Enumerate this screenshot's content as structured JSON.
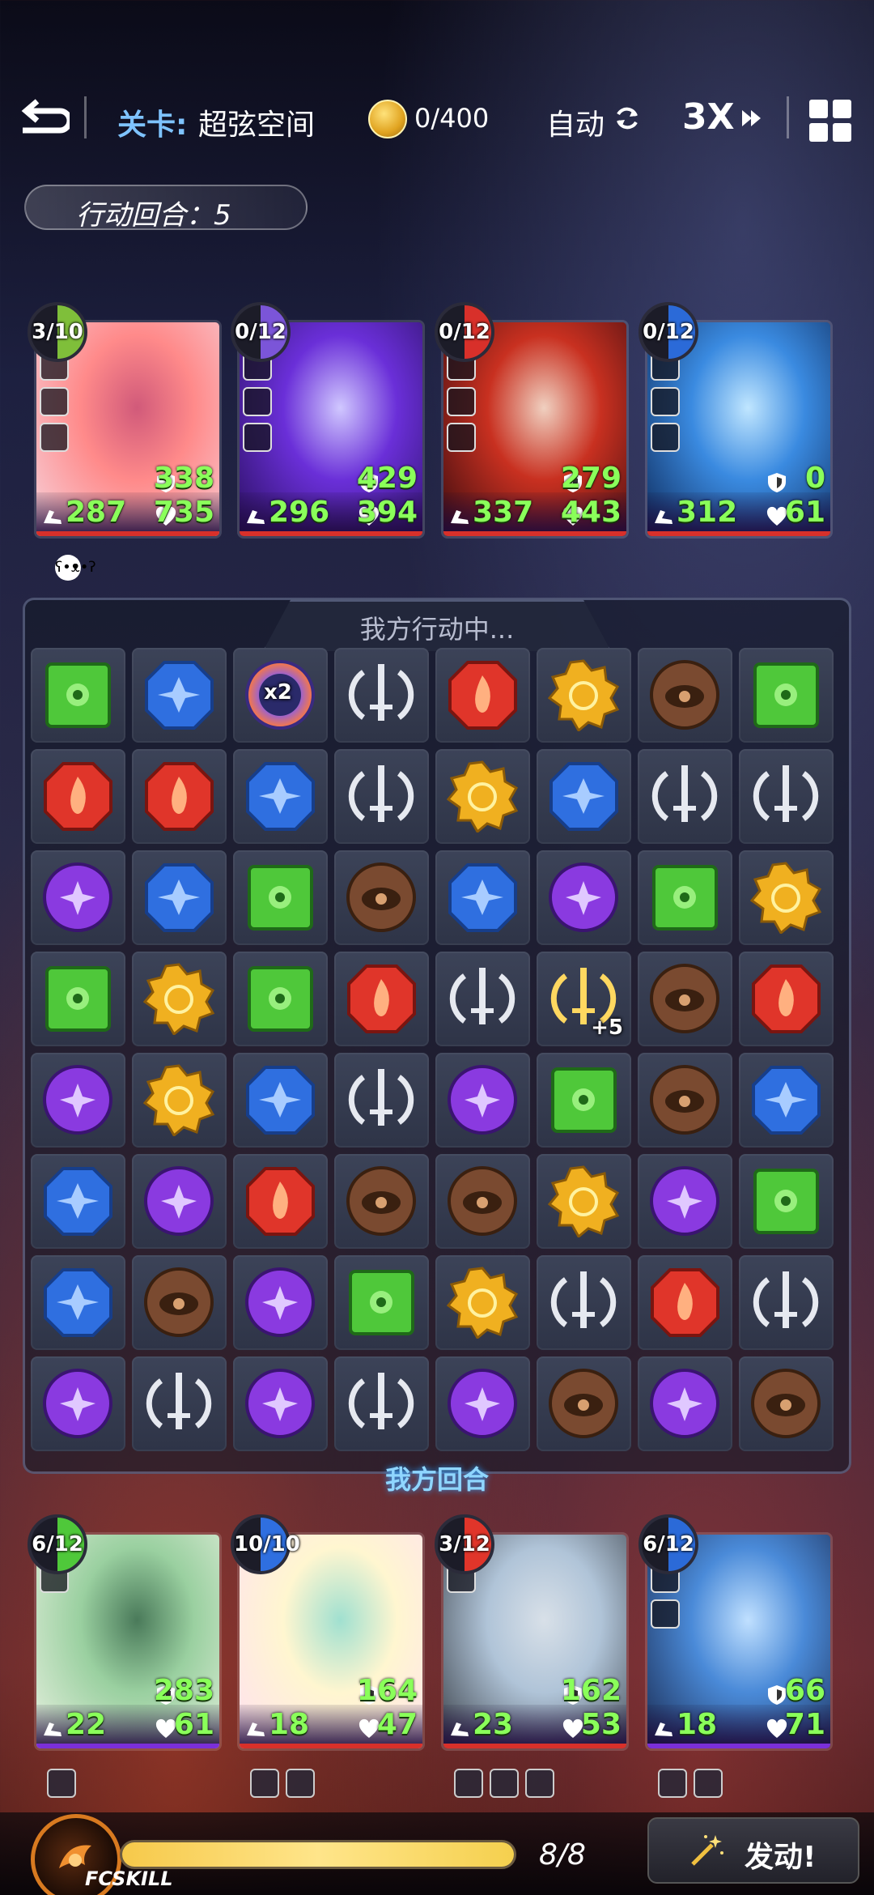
{
  "topbar": {
    "back_icon": "back-arrow-icon",
    "stage_label": "关卡:",
    "stage_name": "超弦空间",
    "coin_icon": "gold-coin-icon",
    "coin_text": "0/400",
    "auto_label": "自动",
    "auto_icon": "refresh-icon",
    "speed_label": "3X",
    "speed_icon": "fast-forward-icon",
    "menu_icon": "grid-menu-icon"
  },
  "turn": {
    "text": "行动回合：5"
  },
  "enemies": [
    {
      "charge": "3/10",
      "shield": "338",
      "attack": "287",
      "hp": "735",
      "badge_color": "#7fbf3a",
      "art": [
        "#ff8a8a",
        "#f6d3dc",
        "#d15a7a"
      ],
      "bar": "red"
    },
    {
      "charge": "0/12",
      "shield": "429",
      "attack": "296",
      "hp": "394",
      "badge_color": "#7b55d8",
      "art": [
        "#6a2fd8",
        "#2a1060",
        "#d0c7ff"
      ],
      "bar": "red"
    },
    {
      "charge": "0/12",
      "shield": "279",
      "attack": "337",
      "hp": "443",
      "badge_color": "#d8302a",
      "art": [
        "#c83020",
        "#3a0c10",
        "#f0d0c0"
      ],
      "bar": "red"
    },
    {
      "charge": "0/12",
      "shield": "0",
      "attack": "312",
      "hp": "61",
      "badge_color": "#2b6ad8",
      "art": [
        "#3a8ae0",
        "#0e2a5a",
        "#c0e6ff"
      ],
      "bar": "red"
    }
  ],
  "board": {
    "status": "我方行动中...",
    "round_label": "我方回合",
    "gem_colors": {
      "green": "#4fc83a",
      "blue": "#2f6fe0",
      "red": "#e0352a",
      "yellow": "#f0b020",
      "brown": "#7a4a30",
      "purple": "#8a3ae0",
      "sword": "#c8ccd6",
      "sword-gold": "#f0c030",
      "rainbow": "#6a6aff"
    },
    "rows": [
      [
        "green",
        "blue",
        "rainbow",
        "sword",
        "red",
        "yellow",
        "brown",
        "green"
      ],
      [
        "red",
        "red",
        "blue",
        "sword",
        "yellow",
        "blue",
        "sword",
        "sword"
      ],
      [
        "purple",
        "blue",
        "green",
        "brown",
        "blue",
        "purple",
        "green",
        "yellow"
      ],
      [
        "green",
        "yellow",
        "green",
        "red",
        "sword",
        "sword-gold",
        "brown",
        "red"
      ],
      [
        "purple",
        "yellow",
        "blue",
        "sword",
        "purple",
        "green",
        "brown",
        "blue"
      ],
      [
        "blue",
        "purple",
        "red",
        "brown",
        "brown",
        "yellow",
        "purple",
        "green"
      ],
      [
        "blue",
        "brown",
        "purple",
        "green",
        "yellow",
        "sword",
        "red",
        "sword"
      ],
      [
        "purple",
        "sword",
        "purple",
        "sword",
        "purple",
        "brown",
        "purple",
        "brown"
      ]
    ],
    "special_labels": {
      "rainbow": "x2",
      "sword-gold": "+5"
    }
  },
  "heroes": [
    {
      "charge": "6/12",
      "shield": "283",
      "attack": "22",
      "hp": "61",
      "badge_color": "#4fc83a",
      "art": [
        "#9ad0a0",
        "#e8f0e0",
        "#4a7a5a"
      ],
      "bar": "purple"
    },
    {
      "charge": "10/10",
      "shield": "164",
      "attack": "18",
      "hp": "47",
      "badge_color": "#2f6fe0",
      "art": [
        "#fff6d0",
        "#ffe0f0",
        "#a0e0d0"
      ],
      "bar": "red"
    },
    {
      "charge": "3/12",
      "shield": "162",
      "attack": "23",
      "hp": "53",
      "badge_color": "#e0352a",
      "art": [
        "#b0c4d8",
        "#3a4048",
        "#d8e0e8"
      ],
      "bar": "red"
    },
    {
      "charge": "6/12",
      "shield": "66",
      "attack": "18",
      "hp": "71",
      "badge_color": "#2b6ad8",
      "art": [
        "#4a8ad8",
        "#1a2a50",
        "#c0e0ff"
      ],
      "bar": "purple"
    }
  ],
  "fc_skill": {
    "label": "FCSKILL",
    "count": "8/8",
    "progress": 1.0,
    "button_label": "发动!",
    "button_icon": "magic-wand-icon"
  }
}
